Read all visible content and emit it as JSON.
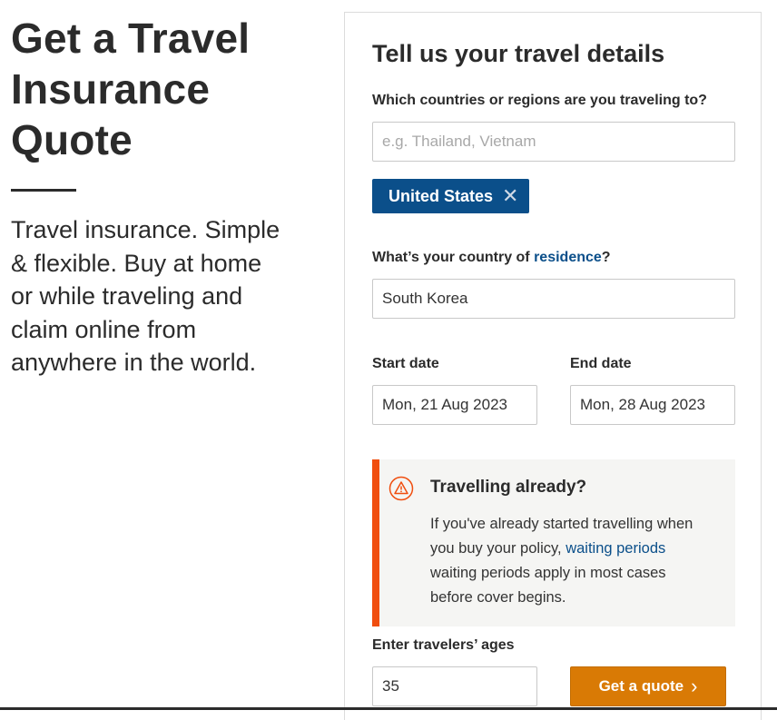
{
  "hero": {
    "title": "Get a Travel Insurance Quote",
    "description": "Travel insurance. Simple & flexible. Buy at home or while traveling and claim online from anywhere in the world."
  },
  "form": {
    "heading": "Tell us your travel details",
    "destinations": {
      "label": "Which countries or regions are you traveling to?",
      "placeholder": "e.g. Thailand, Vietnam",
      "value": "",
      "selected_chip": "United States",
      "chip_remove_symbol": "✕"
    },
    "residence": {
      "label_prefix": "What’s your country of ",
      "label_link": "residence",
      "label_suffix": "?",
      "value": "South Korea"
    },
    "start_date": {
      "label": "Start date",
      "value": "Mon, 21 Aug 2023"
    },
    "end_date": {
      "label": "End date",
      "value": "Mon, 28 Aug 2023"
    },
    "notice": {
      "title": "Travelling already?",
      "body_prefix": "If you've already started travelling when you buy your policy, ",
      "body_link": "waiting periods",
      "body_suffix": " waiting periods apply in most cases before cover begins.",
      "accent_color": "#f04e0f",
      "icon": "warning-triangle-icon"
    },
    "ages": {
      "label": "Enter travelers’ ages",
      "value": "35"
    },
    "submit": {
      "label": "Get a quote",
      "chevron": "›",
      "color": "#d97a05"
    }
  },
  "colors": {
    "brand_blue": "#0b4f8a",
    "text": "#2b2b2b"
  }
}
